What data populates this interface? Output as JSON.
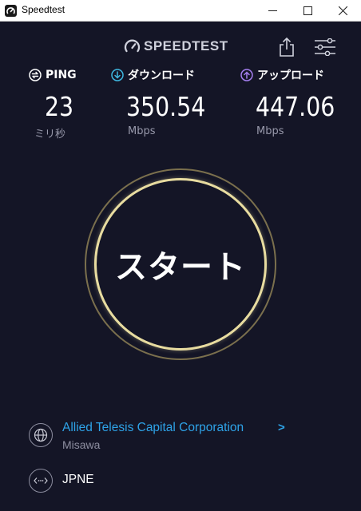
{
  "window": {
    "title": "Speedtest",
    "icon": "speedtest-gauge-icon",
    "controls": [
      "minimize-icon",
      "maximize-icon",
      "close-icon"
    ]
  },
  "header": {
    "brand": "SPEEDTEST",
    "share_icon": "share-icon",
    "settings_icon": "settings-sliders-icon"
  },
  "metrics": {
    "ping": {
      "label": "PING",
      "value": "23",
      "unit": "ミリ秒",
      "icon": "ping-icon"
    },
    "download": {
      "label": "ダウンロード",
      "value": "350.54",
      "unit": "Mbps",
      "icon": "download-arrow-icon"
    },
    "upload": {
      "label": "アップロード",
      "value": "447.06",
      "unit": "Mbps",
      "icon": "upload-arrow-icon"
    }
  },
  "start": {
    "label": "スタート"
  },
  "server": {
    "name": "Allied Telesis Capital Corporation",
    "chevron": ">",
    "location": "Misawa",
    "icon": "globe-icon"
  },
  "isp": {
    "name": "JPNE",
    "icon": "connection-dots-icon"
  },
  "colors": {
    "background": "#141526",
    "ping_icon": "#ffffff",
    "download_icon": "#3fb8e0",
    "upload_icon": "#a57ff0",
    "link": "#2ea3e8",
    "start_ring": "#e8dca0"
  }
}
